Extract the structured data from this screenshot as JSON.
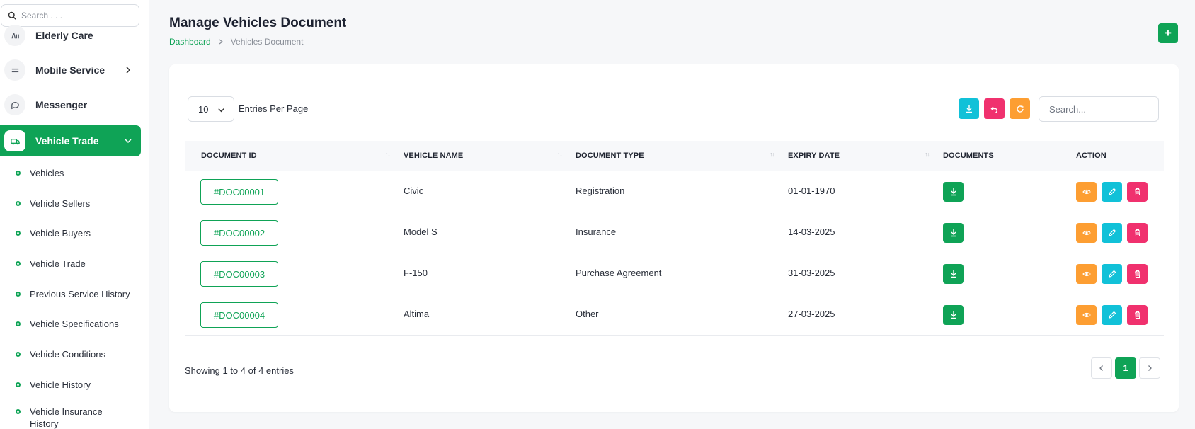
{
  "sidebar": {
    "search_placeholder": "Search . . .",
    "items": [
      {
        "label": "Elderly Care",
        "icon": "elderly-icon"
      },
      {
        "label": "Mobile Service",
        "icon": "menu-lines-icon"
      },
      {
        "label": "Messenger",
        "icon": "chat-bubble-icon"
      },
      {
        "label": "Vehicle Trade",
        "icon": "truck-icon"
      }
    ],
    "sub_items": [
      "Vehicles",
      "Vehicle Sellers",
      "Vehicle Buyers",
      "Vehicle Trade",
      "Previous Service History",
      "Vehicle Specifications",
      "Vehicle Conditions",
      "Vehicle History",
      "Vehicle Insurance History"
    ]
  },
  "header": {
    "title": "Manage Vehicles Document",
    "breadcrumb": [
      "Dashboard",
      "Vehicles Document"
    ]
  },
  "toolbar": {
    "entries_value": "10",
    "entries_label": "Entries Per Page",
    "search_placeholder": "Search..."
  },
  "table": {
    "columns": [
      "DOCUMENT ID",
      "VEHICLE NAME",
      "DOCUMENT TYPE",
      "EXPIRY DATE",
      "DOCUMENTS",
      "ACTION"
    ],
    "rows": [
      {
        "id": "#DOC00001",
        "vehicle": "Civic",
        "type": "Registration",
        "expiry": "01-01-1970"
      },
      {
        "id": "#DOC00002",
        "vehicle": "Model S",
        "type": "Insurance",
        "expiry": "14-03-2025"
      },
      {
        "id": "#DOC00003",
        "vehicle": "F-150",
        "type": "Purchase Agreement",
        "expiry": "31-03-2025"
      },
      {
        "id": "#DOC00004",
        "vehicle": "Altima",
        "type": "Other",
        "expiry": "27-03-2025"
      }
    ]
  },
  "footer": {
    "info": "Showing 1 to 4 of 4 entries",
    "current_page": "1"
  },
  "colors": {
    "primary": "#0fa356",
    "cyan": "#11c1d8",
    "pink": "#f0316e",
    "orange": "#fd9e32"
  }
}
